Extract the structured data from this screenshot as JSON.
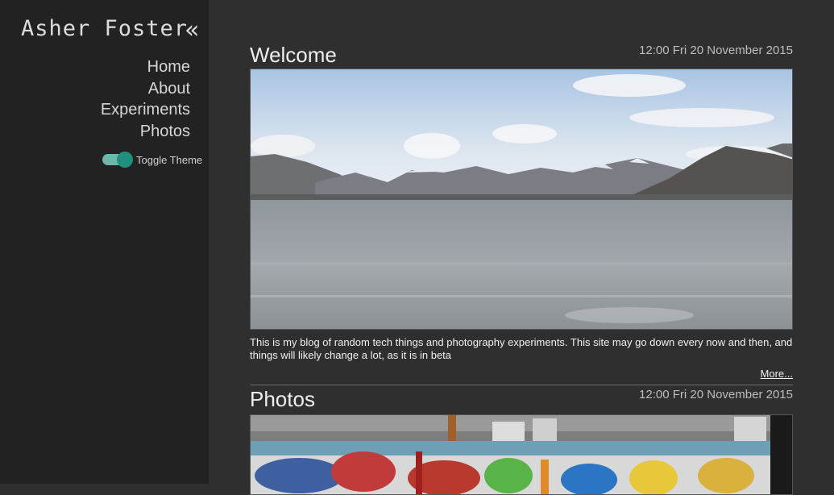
{
  "sidebar": {
    "site_title": "Asher Foster",
    "collapse_icon": "«",
    "nav": [
      {
        "label": "Home"
      },
      {
        "label": "About"
      },
      {
        "label": "Experiments"
      },
      {
        "label": "Photos"
      }
    ],
    "theme_toggle": {
      "label": "Toggle Theme",
      "on": true
    }
  },
  "posts": [
    {
      "title": "Welcome",
      "date": "12:00 Fri 20 November 2015",
      "image": "lake-mountains-photo",
      "text": "This is my blog of random tech things and photography experiments. This site may go down every now and then, and things will likely change a lot, as it is in beta",
      "more_label": "More..."
    },
    {
      "title": "Photos",
      "date": "12:00 Fri 20 November 2015",
      "image": "graffiti-rooftop-photo"
    }
  ],
  "colors": {
    "sidebar_bg": "#222222",
    "main_bg": "#2f2f2f",
    "toggle_accent": "#1f8f7e"
  }
}
